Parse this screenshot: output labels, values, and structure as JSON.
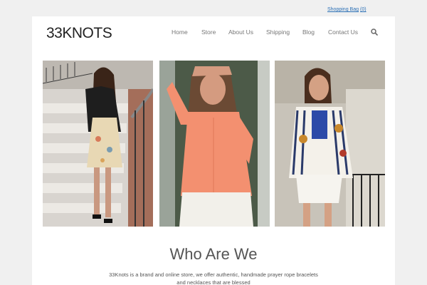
{
  "topbar": {
    "bag_label": "Shopping Bag",
    "bag_count": "(0)"
  },
  "header": {
    "logo": "33KNOTS"
  },
  "nav": {
    "items": [
      {
        "label": "Home"
      },
      {
        "label": "Store"
      },
      {
        "label": "About Us"
      },
      {
        "label": "Shipping"
      },
      {
        "label": "Blog"
      },
      {
        "label": "Contact Us"
      }
    ],
    "search_icon": "search-icon"
  },
  "gallery": {
    "photos": [
      {
        "icon": "photo-model-stairs"
      },
      {
        "icon": "photo-model-orange-blouse"
      },
      {
        "icon": "photo-model-patterned-jacket"
      }
    ]
  },
  "about": {
    "title": "Who Are We",
    "text": "33Knots is a brand and online store, we offer authentic, handmade prayer rope bracelets and necklaces that are blessed"
  },
  "colors": {
    "link": "#2a6fb5",
    "background": "#f0f0f0",
    "accent_orange": "#f39070"
  }
}
